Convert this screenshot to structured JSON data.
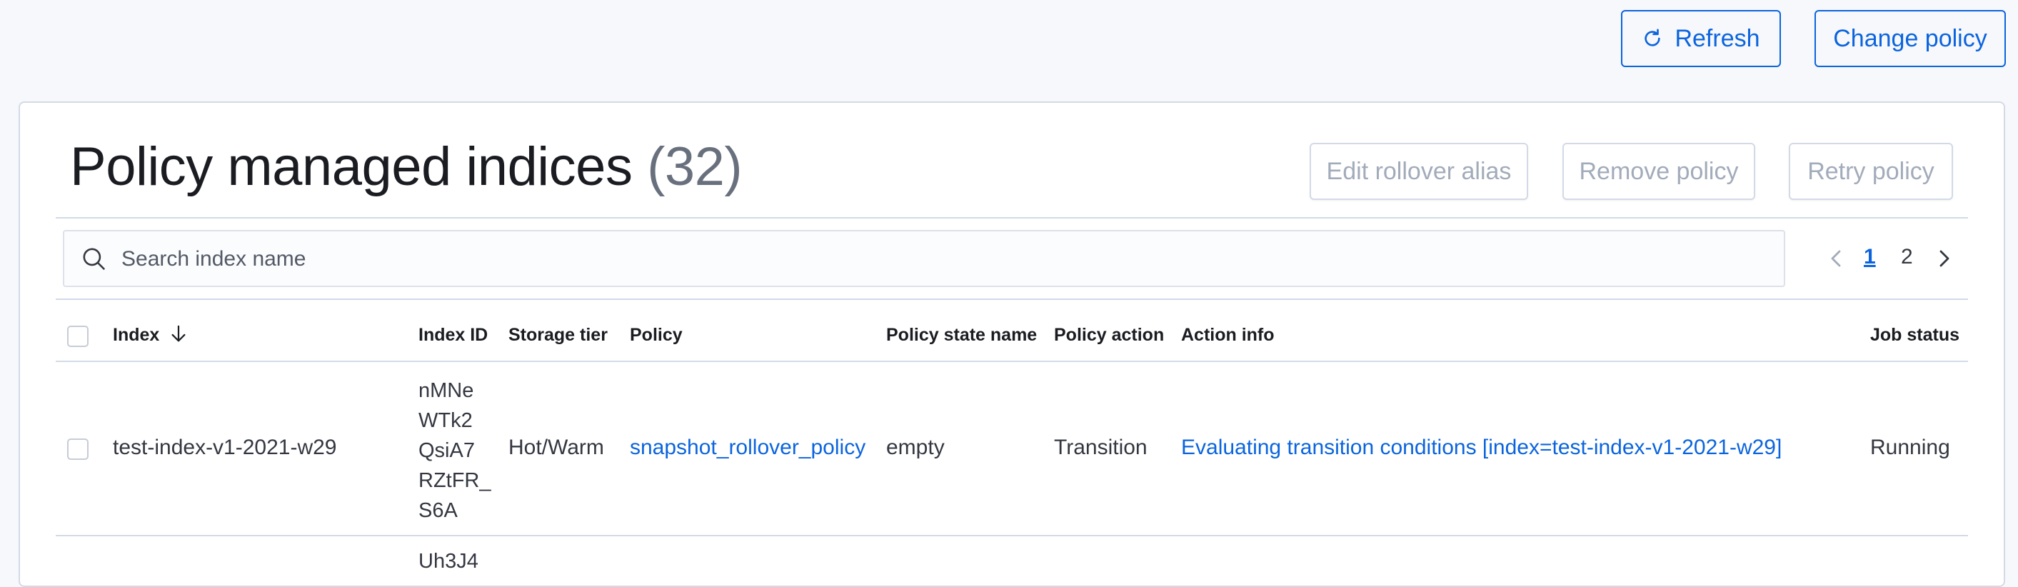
{
  "header": {
    "refresh_label": "Refresh",
    "change_policy_label": "Change policy"
  },
  "panel": {
    "title": "Policy managed indices",
    "count": "(32)",
    "edit_rollover_label": "Edit rollover alias",
    "remove_policy_label": "Remove policy",
    "retry_policy_label": "Retry policy"
  },
  "search": {
    "placeholder": "Search index name"
  },
  "pagination": {
    "current_page": "1",
    "next_page": "2"
  },
  "table": {
    "columns": {
      "index": "Index",
      "index_id": "Index ID",
      "storage_tier": "Storage tier",
      "policy": "Policy",
      "policy_state": "Policy state name",
      "policy_action": "Policy action",
      "action_info": "Action info",
      "job_status": "Job status"
    },
    "sort_direction": "descending",
    "rows": [
      {
        "index": "test-index-v1-2021-w29",
        "index_id_lines": [
          "nMNe",
          "WTk2",
          "QsiA7",
          "RZtFR_",
          "S6A"
        ],
        "storage_tier": "Hot/Warm",
        "policy": "snapshot_rollover_policy",
        "policy_state": "empty",
        "policy_action": "Transition",
        "action_info": "Evaluating transition conditions [index=test-index-v1-2021-w29]",
        "job_status": "Running"
      },
      {
        "index_id_lines": [
          "Uh3J4"
        ]
      }
    ]
  },
  "colors": {
    "accent": "#0b64dd",
    "border": "#d3dae6",
    "background": "#f7f8fc"
  }
}
